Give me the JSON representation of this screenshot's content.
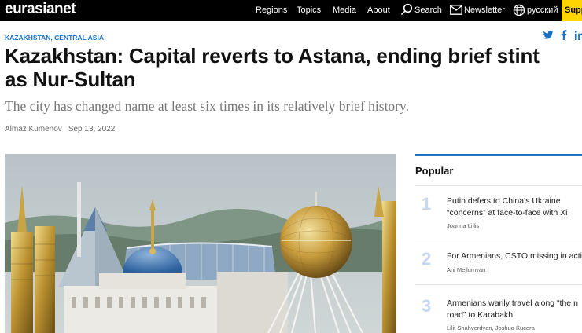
{
  "brand": {
    "logo": "eurasianet",
    "accent": "#1a73c9",
    "support_color": "#ffd400"
  },
  "nav": {
    "items": [
      "Regions",
      "Topics",
      "Media",
      "About"
    ],
    "search_label": "Search",
    "newsletter_label": "Newsletter",
    "language_label": "русский",
    "support_label": "Supp"
  },
  "article": {
    "kicker_1": "KAZAKHSTAN",
    "kicker_sep": ",",
    "kicker_2": "CENTRAL ASIA",
    "title_line1": "Kazakhstan: Capital reverts to Astana, ending brief stint",
    "title_line2": "as Nur-Sultan",
    "subtitle": "The city has changed name at least six times in its relatively brief history.",
    "author": "Almaz Kumenov",
    "date": "Sep 13, 2022",
    "share_icons": [
      "twitter-icon",
      "facebook-icon",
      "linkedin-icon"
    ]
  },
  "popular": {
    "title": "Popular",
    "items": [
      {
        "num": "1",
        "headline": "Putin defers to China’s Ukraine “concerns” at face-to-face with Xi",
        "author": "Joanna Lillis"
      },
      {
        "num": "2",
        "headline": "For Armenians, CSTO missing in acti",
        "author": "Ani Mejlumyan"
      },
      {
        "num": "3",
        "headline": "Armenians warily travel along “the n road” to Karabakh",
        "author": "Lilit Shahverdyan, Joshua Kucera"
      }
    ]
  }
}
